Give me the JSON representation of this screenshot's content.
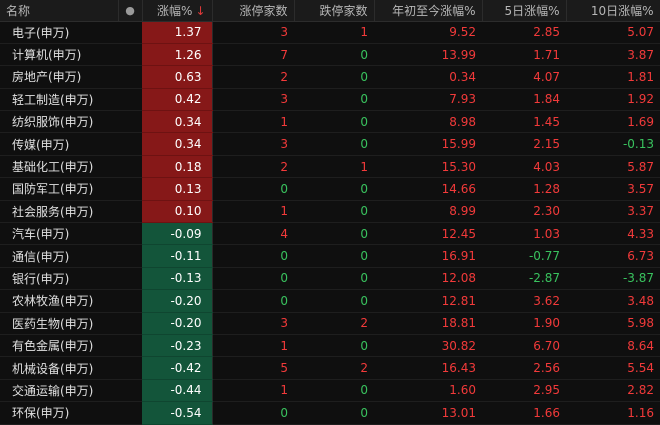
{
  "header": {
    "name": "名称",
    "dot": "●",
    "change": "涨幅%",
    "sort_icon": "↓",
    "limit_up": "涨停家数",
    "limit_down": "跌停家数",
    "ytd": "年初至今涨幅%",
    "d5": "5日涨幅%",
    "d10": "10日涨幅%"
  },
  "colors": {
    "up": "#f23a3a",
    "down": "#39c25e",
    "up_bg": "#861818",
    "down_bg": "#13553a"
  },
  "rows": [
    {
      "name": "电子(申万)",
      "change": "1.37",
      "limit_up": "3",
      "limit_down": "1",
      "ytd": "9.52",
      "d5": "2.85",
      "d10": "5.07"
    },
    {
      "name": "计算机(申万)",
      "change": "1.26",
      "limit_up": "7",
      "limit_down": "0",
      "ytd": "13.99",
      "d5": "1.71",
      "d10": "3.87"
    },
    {
      "name": "房地产(申万)",
      "change": "0.63",
      "limit_up": "2",
      "limit_down": "0",
      "ytd": "0.34",
      "d5": "4.07",
      "d10": "1.81"
    },
    {
      "name": "轻工制造(申万)",
      "change": "0.42",
      "limit_up": "3",
      "limit_down": "0",
      "ytd": "7.93",
      "d5": "1.84",
      "d10": "1.92"
    },
    {
      "name": "纺织服饰(申万)",
      "change": "0.34",
      "limit_up": "1",
      "limit_down": "0",
      "ytd": "8.98",
      "d5": "1.45",
      "d10": "1.69"
    },
    {
      "name": "传媒(申万)",
      "change": "0.34",
      "limit_up": "3",
      "limit_down": "0",
      "ytd": "15.99",
      "d5": "2.15",
      "d10": "-0.13"
    },
    {
      "name": "基础化工(申万)",
      "change": "0.18",
      "limit_up": "2",
      "limit_down": "1",
      "ytd": "15.30",
      "d5": "4.03",
      "d10": "5.87"
    },
    {
      "name": "国防军工(申万)",
      "change": "0.13",
      "limit_up": "0",
      "limit_down": "0",
      "ytd": "14.66",
      "d5": "1.28",
      "d10": "3.57"
    },
    {
      "name": "社会服务(申万)",
      "change": "0.10",
      "limit_up": "1",
      "limit_down": "0",
      "ytd": "8.99",
      "d5": "2.30",
      "d10": "3.37"
    },
    {
      "name": "汽车(申万)",
      "change": "-0.09",
      "limit_up": "4",
      "limit_down": "0",
      "ytd": "12.45",
      "d5": "1.03",
      "d10": "4.33"
    },
    {
      "name": "通信(申万)",
      "change": "-0.11",
      "limit_up": "0",
      "limit_down": "0",
      "ytd": "16.91",
      "d5": "-0.77",
      "d10": "6.73"
    },
    {
      "name": "银行(申万)",
      "change": "-0.13",
      "limit_up": "0",
      "limit_down": "0",
      "ytd": "12.08",
      "d5": "-2.87",
      "d10": "-3.87"
    },
    {
      "name": "农林牧渔(申万)",
      "change": "-0.20",
      "limit_up": "0",
      "limit_down": "0",
      "ytd": "12.81",
      "d5": "3.62",
      "d10": "3.48"
    },
    {
      "name": "医药生物(申万)",
      "change": "-0.20",
      "limit_up": "3",
      "limit_down": "2",
      "ytd": "18.81",
      "d5": "1.90",
      "d10": "5.98"
    },
    {
      "name": "有色金属(申万)",
      "change": "-0.23",
      "limit_up": "1",
      "limit_down": "0",
      "ytd": "30.82",
      "d5": "6.70",
      "d10": "8.64"
    },
    {
      "name": "机械设备(申万)",
      "change": "-0.42",
      "limit_up": "5",
      "limit_down": "2",
      "ytd": "16.43",
      "d5": "2.56",
      "d10": "5.54"
    },
    {
      "name": "交通运输(申万)",
      "change": "-0.44",
      "limit_up": "1",
      "limit_down": "0",
      "ytd": "1.60",
      "d5": "2.95",
      "d10": "2.82"
    },
    {
      "name": "环保(申万)",
      "change": "-0.54",
      "limit_up": "0",
      "limit_down": "0",
      "ytd": "13.01",
      "d5": "1.66",
      "d10": "1.16"
    }
  ]
}
